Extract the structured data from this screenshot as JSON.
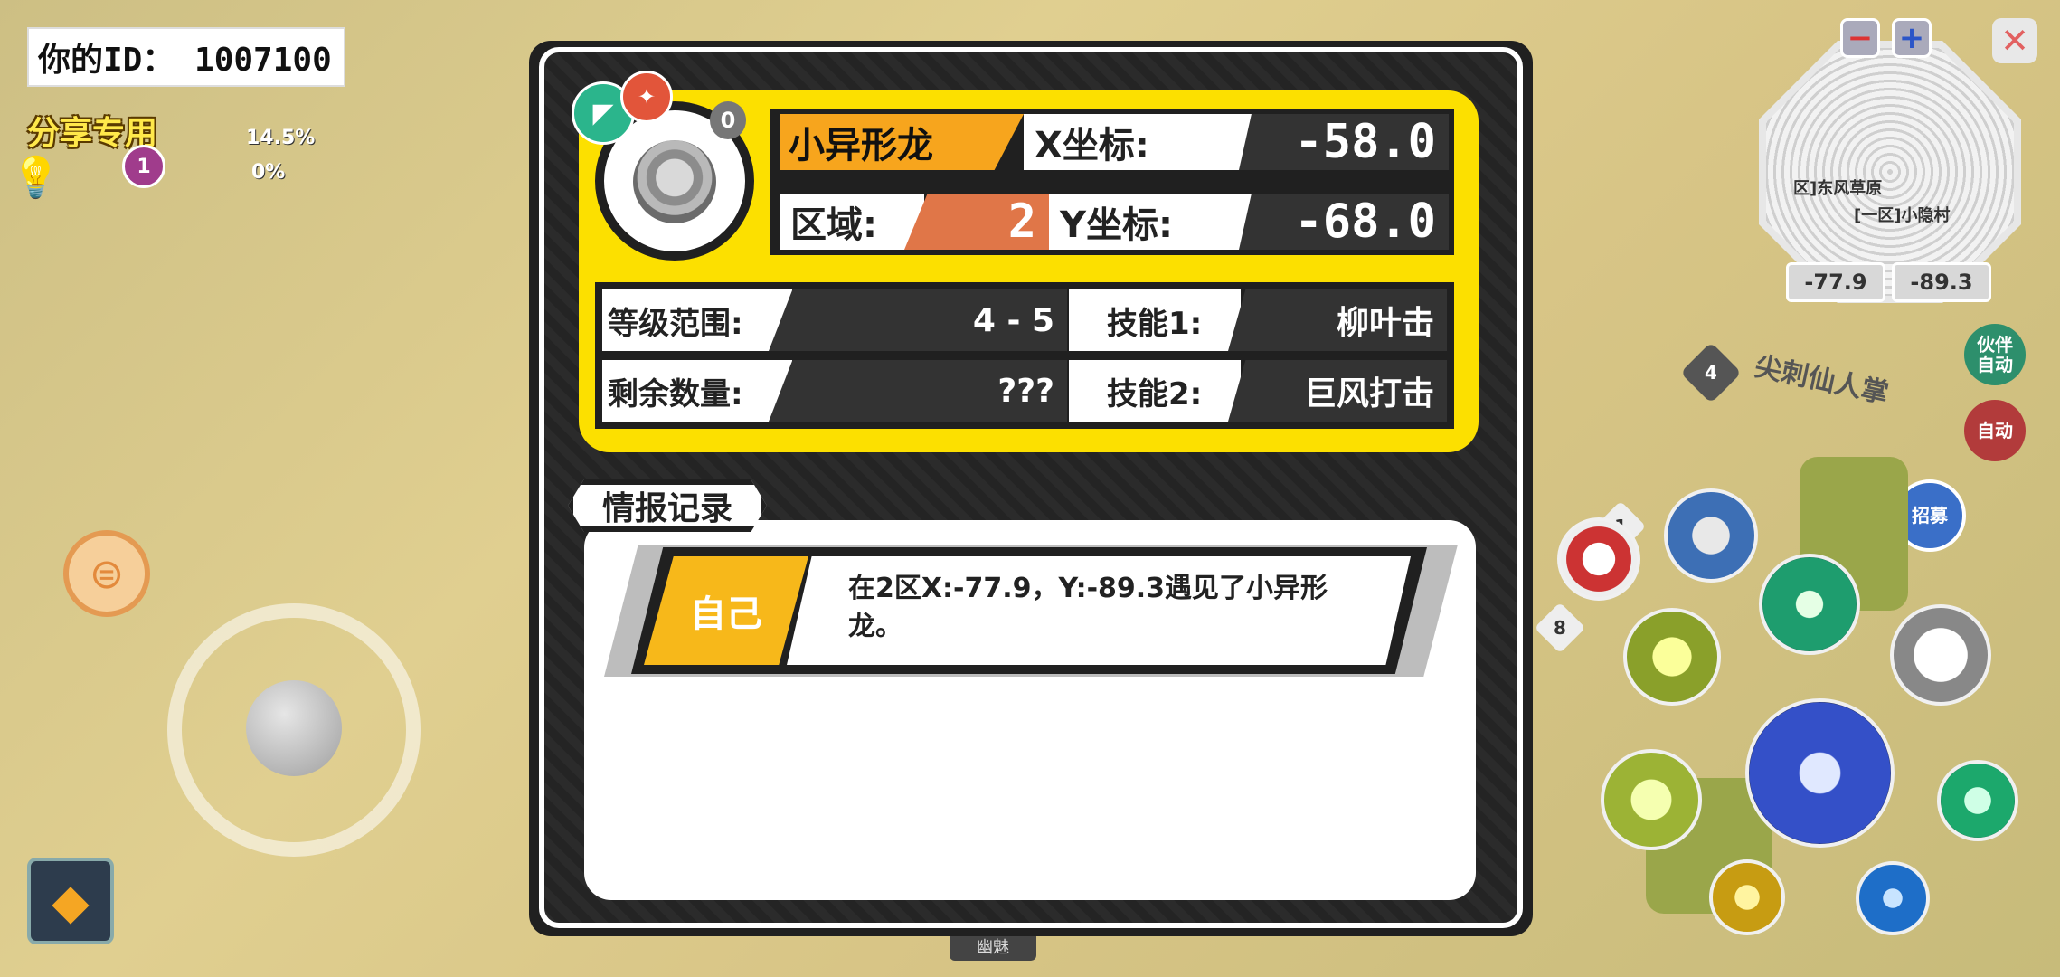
{
  "hud": {
    "player_id": "你的ID：  1007100",
    "share_label": "分享专用",
    "exp_percent": "14.5%",
    "second_percent": "0%",
    "level_badge": "1"
  },
  "minimap": {
    "zoom_out_label": "−",
    "zoom_in_label": "+",
    "close_label": "✕",
    "area_label_1": "区]东风草原",
    "area_label_2": "[一区]小隐村",
    "coord_x": "-77.9",
    "coord_y": "-89.3"
  },
  "world": {
    "label_partner_auto": "伙伴\n自动",
    "label_auto": "自动",
    "label_summon": "招募",
    "enemy_name": "尖刺仙人掌",
    "enemy_level": "4",
    "level_1": "1",
    "level_8": "8",
    "bottom_label": "幽魅"
  },
  "card": {
    "name": "小异形龙",
    "x_label": "X坐标:",
    "x_value": "-58.0",
    "y_label": "Y坐标:",
    "y_value": "-68.0",
    "zone_label": "区域:",
    "zone_value": "2",
    "badge_number": "0",
    "level_range_label": "等级范围:",
    "level_range_value": "4 - 5",
    "remaining_label": "剩余数量:",
    "remaining_value": "???",
    "skill1_label": "技能1:",
    "skill1_value": "柳叶击",
    "skill2_label": "技能2:",
    "skill2_value": "巨风打击"
  },
  "log": {
    "tab_title": "情报记录",
    "entries": [
      {
        "who": "自己",
        "message": "在2区X:-77.9，Y:-89.3遇见了小异形龙。"
      }
    ]
  },
  "colors": {
    "card_yellow": "#fce000",
    "name_orange": "#f7a51d",
    "zone_orange": "#e07648",
    "dark": "#202020"
  }
}
